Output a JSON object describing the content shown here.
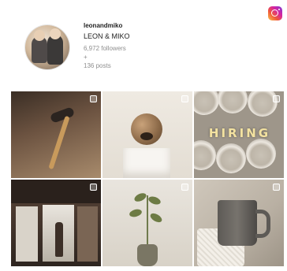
{
  "profile": {
    "username": "leonandmiko",
    "full_name": "LEON & MIKO",
    "followers": "6,972 followers",
    "separator": "+",
    "posts": "136 posts"
  },
  "brand": {
    "icon": "instagram-icon"
  },
  "grid": {
    "posts": [
      {
        "icon": "image-post",
        "overlay_text": ""
      },
      {
        "icon": "image-post",
        "overlay_text": ""
      },
      {
        "icon": "image-post",
        "overlay_text": "HIRING"
      },
      {
        "icon": "image-post",
        "overlay_text": ""
      },
      {
        "icon": "image-post",
        "overlay_text": ""
      },
      {
        "icon": "image-post",
        "overlay_text": ""
      }
    ]
  }
}
